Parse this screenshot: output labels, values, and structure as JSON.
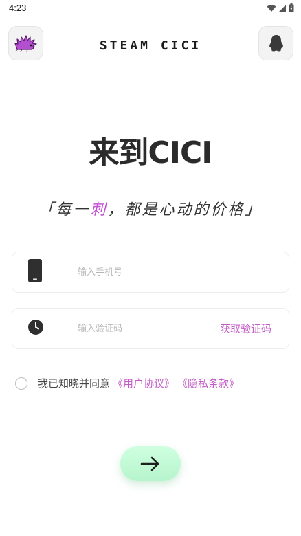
{
  "status_bar": {
    "time": "4:23",
    "icons": [
      "wifi-icon",
      "signal-icon",
      "battery-icon"
    ]
  },
  "header": {
    "brand": "STEAM CICI",
    "left_icon": "hedgehog-logo-icon",
    "right_icon": "qq-penguin-icon"
  },
  "hero": {
    "title": "来到CICI",
    "slogan_open": "「每一",
    "slogan_highlight": "刺",
    "slogan_close": "，都是心动的价格」"
  },
  "form": {
    "phone": {
      "placeholder": "输入手机号",
      "value": "",
      "icon": "phone-icon"
    },
    "code": {
      "placeholder": "输入验证码",
      "value": "",
      "icon": "clock-icon"
    },
    "get_code_label": "获取验证码"
  },
  "agreement": {
    "prefix": "我已知晓并同意",
    "user_agreement": "《用户协议》",
    "privacy_policy": "《隐私条款》",
    "checked": false
  },
  "submit": {
    "icon": "arrow-right-icon"
  },
  "colors": {
    "accent": "#c45cc8",
    "submit_bg": "#c4f9d8",
    "text_dark": "#2b2b2b"
  }
}
